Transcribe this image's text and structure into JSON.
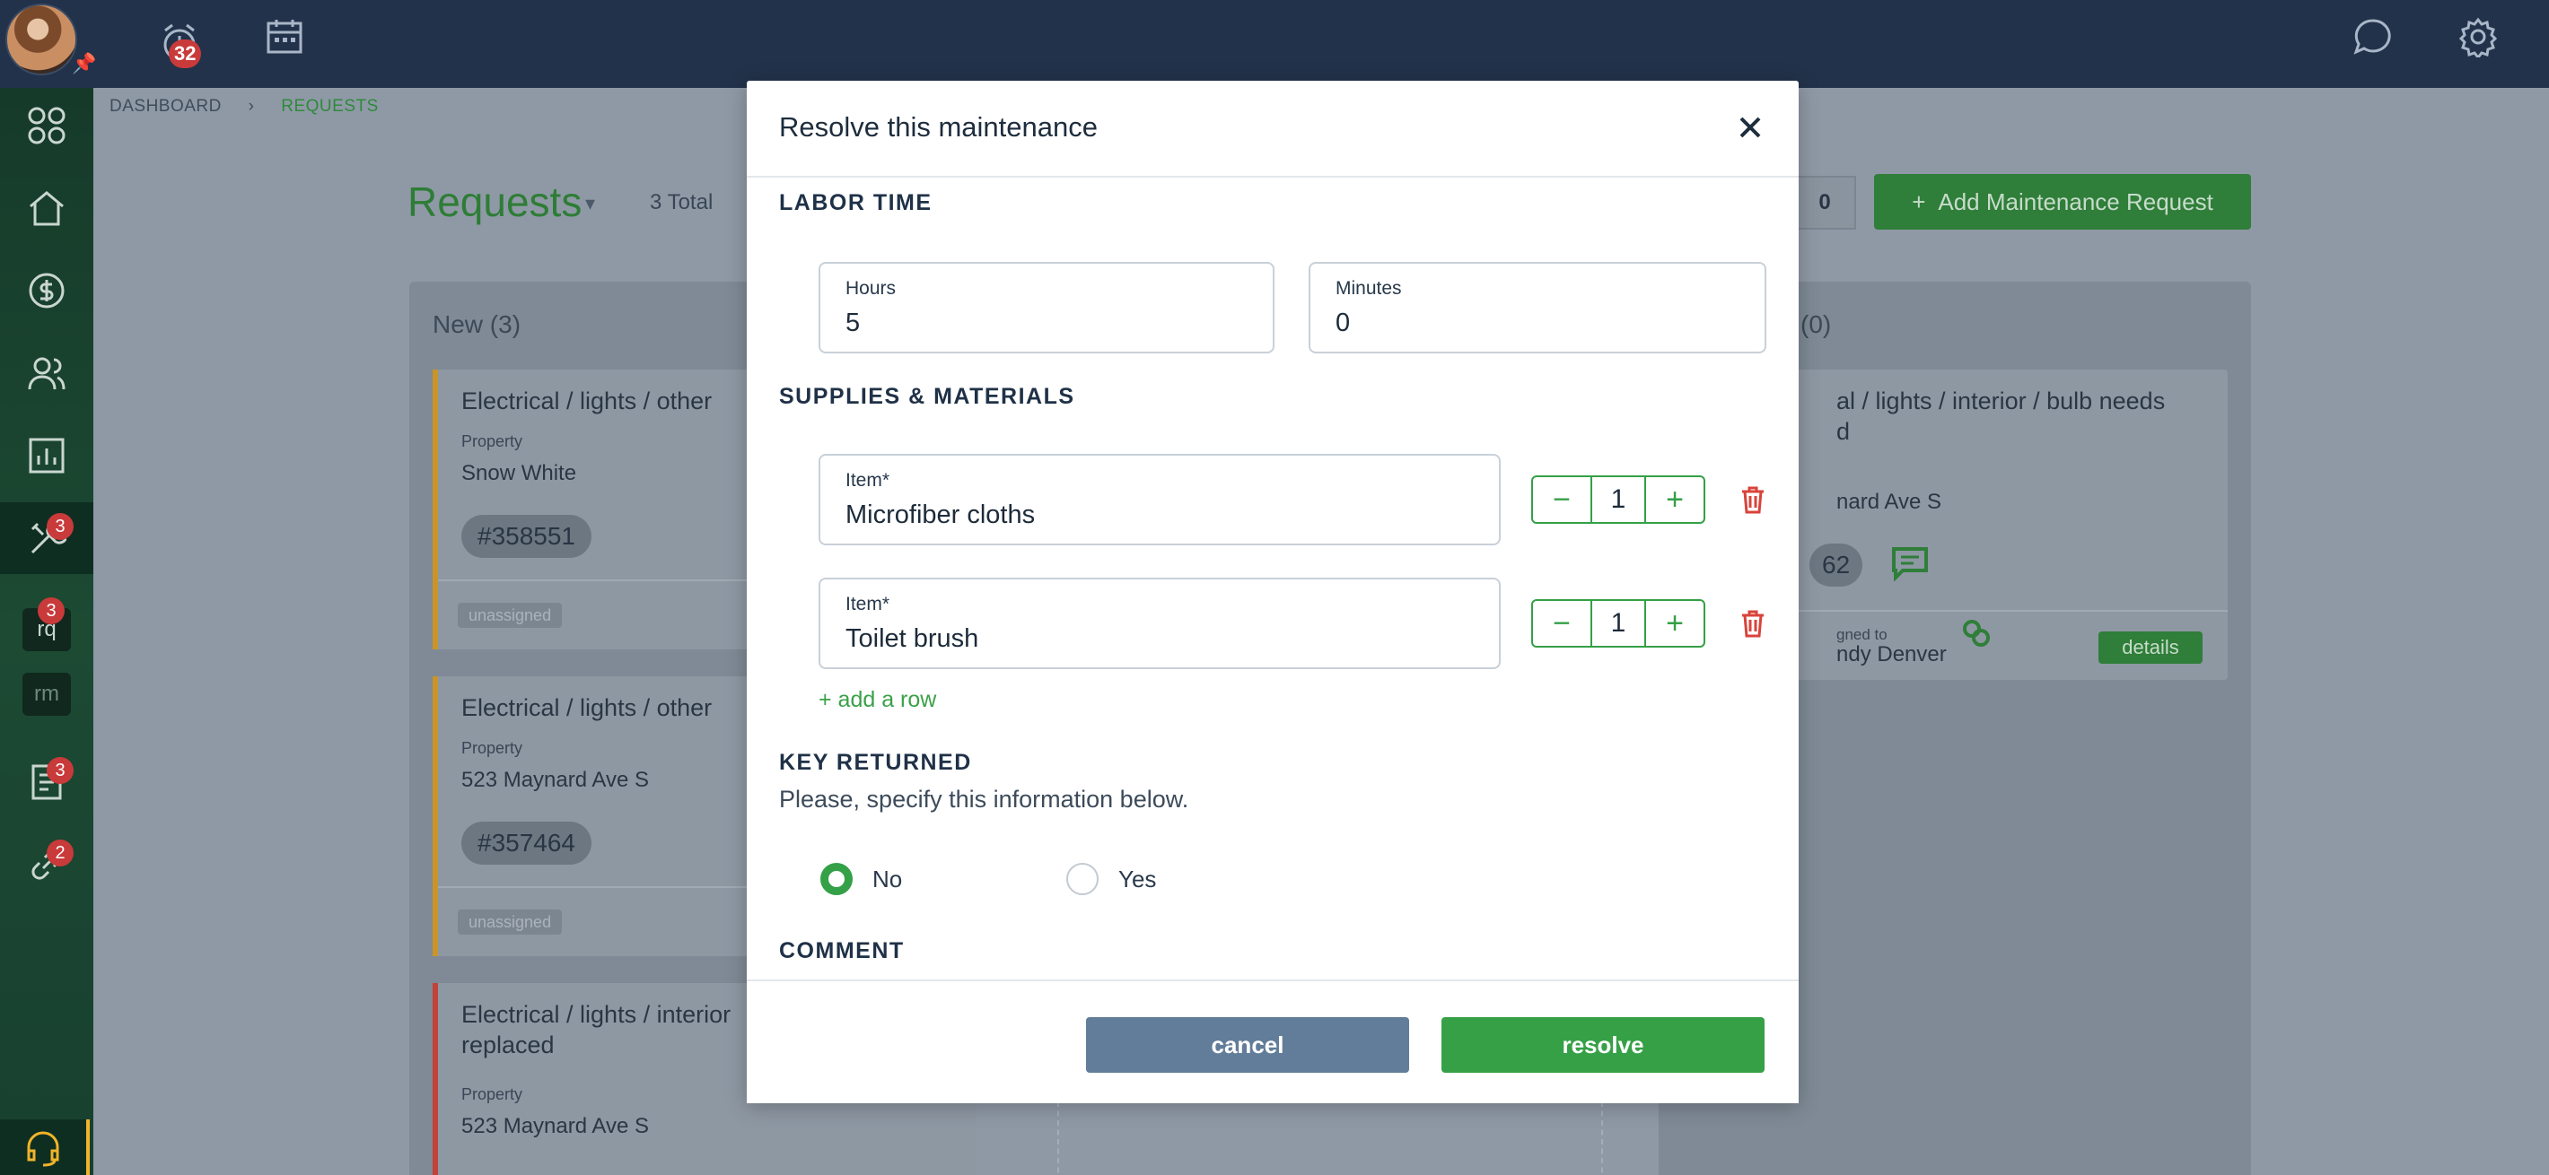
{
  "topbar": {
    "alerts_count": "32",
    "icons": [
      "alarm-clock-icon",
      "calendar-icon",
      "chat-bubble-icon",
      "gear-icon"
    ]
  },
  "sidebar": {
    "items": [
      {
        "name": "apps-grid-icon"
      },
      {
        "name": "home-icon"
      },
      {
        "name": "dollar-icon"
      },
      {
        "name": "people-icon"
      },
      {
        "name": "chart-icon"
      },
      {
        "name": "tools-icon",
        "badge": "3"
      },
      {
        "label": "rq",
        "badge": "3"
      },
      {
        "label": "rm"
      },
      {
        "name": "document-icon",
        "badge": "3"
      },
      {
        "name": "link-icon",
        "badge": "2"
      },
      {
        "name": "headset-icon"
      }
    ]
  },
  "breadcrumb": {
    "root": "DASHBOARD",
    "current": "REQUESTS"
  },
  "header": {
    "title": "Requests",
    "total": "3 Total",
    "filter_count": "0",
    "add_button": "Add Maintenance Request"
  },
  "columns": {
    "new_title": "New (3)",
    "right_title": "(0)",
    "cards": [
      {
        "title": "Electrical / lights / other",
        "property_label": "Property",
        "property": "Snow White",
        "number": "#358551",
        "assignee": "unassigned"
      },
      {
        "title": "Electrical / lights / other",
        "property_label": "Property",
        "property": "523 Maynard Ave S",
        "number": "#357464",
        "assignee": "unassigned"
      },
      {
        "title_line1": "Electrical / lights / interior",
        "title_line2": "replaced",
        "property_label": "Property",
        "property": "523 Maynard Ave S"
      }
    ],
    "right_card": {
      "title_line1": "al / lights / interior / bulb needs",
      "title_line2": "d",
      "property": "nard Ave S",
      "number": "62",
      "assigned_label": "gned to",
      "assignee": "ndy Denver",
      "details": "details"
    }
  },
  "modal": {
    "title": "Resolve this maintenance",
    "labor_time_heading": "LABOR TIME",
    "hours_label": "Hours",
    "hours_value": "5",
    "minutes_label": "Minutes",
    "minutes_value": "0",
    "supplies_heading": "SUPPLIES & MATERIALS",
    "items": [
      {
        "label": "Item*",
        "value": "Microfiber cloths",
        "qty": "1"
      },
      {
        "label": "Item*",
        "value": "Toilet brush",
        "qty": "1"
      }
    ],
    "add_row": "+ add a row",
    "key_returned_heading": "KEY RETURNED",
    "key_helper": "Please, specify this information below.",
    "radio_no": "No",
    "radio_yes": "Yes",
    "selected": "No",
    "comment_heading": "COMMENT",
    "cancel": "cancel",
    "resolve": "resolve"
  },
  "colors": {
    "accent_green": "#36a047",
    "cancel_blue": "#627d99",
    "annotation_red": "#e8221c",
    "navy": "#22324a"
  }
}
